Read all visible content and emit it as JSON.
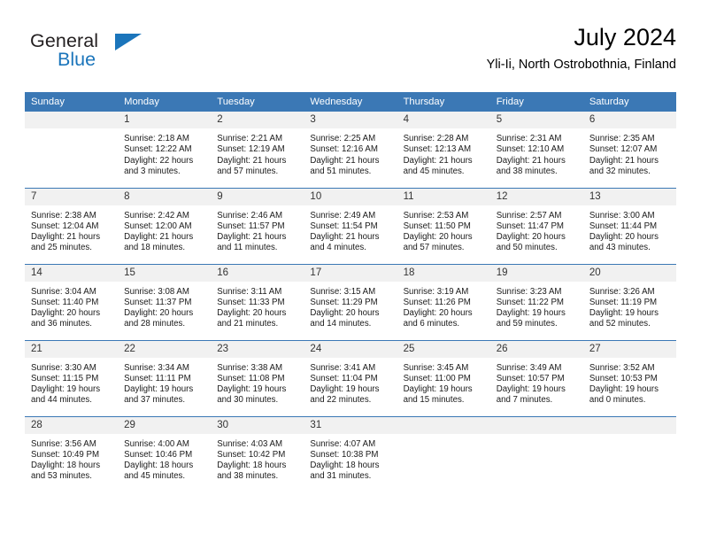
{
  "brand": {
    "word1": "General",
    "word2": "Blue",
    "accent_color": "#1b75bb",
    "triangle_icon": "triangle-icon"
  },
  "header": {
    "title": "July 2024",
    "subtitle": "Yli-Ii, North Ostrobothnia, Finland"
  },
  "calendar": {
    "header_color": "#3b78b5",
    "daynum_bg": "#f1f1f1",
    "weekdays": [
      "Sunday",
      "Monday",
      "Tuesday",
      "Wednesday",
      "Thursday",
      "Friday",
      "Saturday"
    ],
    "weeks": [
      [
        {
          "day": "",
          "empty": true
        },
        {
          "day": "1",
          "sunrise": "Sunrise: 2:18 AM",
          "sunset": "Sunset: 12:22 AM",
          "daylight1": "Daylight: 22 hours",
          "daylight2": "and 3 minutes."
        },
        {
          "day": "2",
          "sunrise": "Sunrise: 2:21 AM",
          "sunset": "Sunset: 12:19 AM",
          "daylight1": "Daylight: 21 hours",
          "daylight2": "and 57 minutes."
        },
        {
          "day": "3",
          "sunrise": "Sunrise: 2:25 AM",
          "sunset": "Sunset: 12:16 AM",
          "daylight1": "Daylight: 21 hours",
          "daylight2": "and 51 minutes."
        },
        {
          "day": "4",
          "sunrise": "Sunrise: 2:28 AM",
          "sunset": "Sunset: 12:13 AM",
          "daylight1": "Daylight: 21 hours",
          "daylight2": "and 45 minutes."
        },
        {
          "day": "5",
          "sunrise": "Sunrise: 2:31 AM",
          "sunset": "Sunset: 12:10 AM",
          "daylight1": "Daylight: 21 hours",
          "daylight2": "and 38 minutes."
        },
        {
          "day": "6",
          "sunrise": "Sunrise: 2:35 AM",
          "sunset": "Sunset: 12:07 AM",
          "daylight1": "Daylight: 21 hours",
          "daylight2": "and 32 minutes."
        }
      ],
      [
        {
          "day": "7",
          "sunrise": "Sunrise: 2:38 AM",
          "sunset": "Sunset: 12:04 AM",
          "daylight1": "Daylight: 21 hours",
          "daylight2": "and 25 minutes."
        },
        {
          "day": "8",
          "sunrise": "Sunrise: 2:42 AM",
          "sunset": "Sunset: 12:00 AM",
          "daylight1": "Daylight: 21 hours",
          "daylight2": "and 18 minutes."
        },
        {
          "day": "9",
          "sunrise": "Sunrise: 2:46 AM",
          "sunset": "Sunset: 11:57 PM",
          "daylight1": "Daylight: 21 hours",
          "daylight2": "and 11 minutes."
        },
        {
          "day": "10",
          "sunrise": "Sunrise: 2:49 AM",
          "sunset": "Sunset: 11:54 PM",
          "daylight1": "Daylight: 21 hours",
          "daylight2": "and 4 minutes."
        },
        {
          "day": "11",
          "sunrise": "Sunrise: 2:53 AM",
          "sunset": "Sunset: 11:50 PM",
          "daylight1": "Daylight: 20 hours",
          "daylight2": "and 57 minutes."
        },
        {
          "day": "12",
          "sunrise": "Sunrise: 2:57 AM",
          "sunset": "Sunset: 11:47 PM",
          "daylight1": "Daylight: 20 hours",
          "daylight2": "and 50 minutes."
        },
        {
          "day": "13",
          "sunrise": "Sunrise: 3:00 AM",
          "sunset": "Sunset: 11:44 PM",
          "daylight1": "Daylight: 20 hours",
          "daylight2": "and 43 minutes."
        }
      ],
      [
        {
          "day": "14",
          "sunrise": "Sunrise: 3:04 AM",
          "sunset": "Sunset: 11:40 PM",
          "daylight1": "Daylight: 20 hours",
          "daylight2": "and 36 minutes."
        },
        {
          "day": "15",
          "sunrise": "Sunrise: 3:08 AM",
          "sunset": "Sunset: 11:37 PM",
          "daylight1": "Daylight: 20 hours",
          "daylight2": "and 28 minutes."
        },
        {
          "day": "16",
          "sunrise": "Sunrise: 3:11 AM",
          "sunset": "Sunset: 11:33 PM",
          "daylight1": "Daylight: 20 hours",
          "daylight2": "and 21 minutes."
        },
        {
          "day": "17",
          "sunrise": "Sunrise: 3:15 AM",
          "sunset": "Sunset: 11:29 PM",
          "daylight1": "Daylight: 20 hours",
          "daylight2": "and 14 minutes."
        },
        {
          "day": "18",
          "sunrise": "Sunrise: 3:19 AM",
          "sunset": "Sunset: 11:26 PM",
          "daylight1": "Daylight: 20 hours",
          "daylight2": "and 6 minutes."
        },
        {
          "day": "19",
          "sunrise": "Sunrise: 3:23 AM",
          "sunset": "Sunset: 11:22 PM",
          "daylight1": "Daylight: 19 hours",
          "daylight2": "and 59 minutes."
        },
        {
          "day": "20",
          "sunrise": "Sunrise: 3:26 AM",
          "sunset": "Sunset: 11:19 PM",
          "daylight1": "Daylight: 19 hours",
          "daylight2": "and 52 minutes."
        }
      ],
      [
        {
          "day": "21",
          "sunrise": "Sunrise: 3:30 AM",
          "sunset": "Sunset: 11:15 PM",
          "daylight1": "Daylight: 19 hours",
          "daylight2": "and 44 minutes."
        },
        {
          "day": "22",
          "sunrise": "Sunrise: 3:34 AM",
          "sunset": "Sunset: 11:11 PM",
          "daylight1": "Daylight: 19 hours",
          "daylight2": "and 37 minutes."
        },
        {
          "day": "23",
          "sunrise": "Sunrise: 3:38 AM",
          "sunset": "Sunset: 11:08 PM",
          "daylight1": "Daylight: 19 hours",
          "daylight2": "and 30 minutes."
        },
        {
          "day": "24",
          "sunrise": "Sunrise: 3:41 AM",
          "sunset": "Sunset: 11:04 PM",
          "daylight1": "Daylight: 19 hours",
          "daylight2": "and 22 minutes."
        },
        {
          "day": "25",
          "sunrise": "Sunrise: 3:45 AM",
          "sunset": "Sunset: 11:00 PM",
          "daylight1": "Daylight: 19 hours",
          "daylight2": "and 15 minutes."
        },
        {
          "day": "26",
          "sunrise": "Sunrise: 3:49 AM",
          "sunset": "Sunset: 10:57 PM",
          "daylight1": "Daylight: 19 hours",
          "daylight2": "and 7 minutes."
        },
        {
          "day": "27",
          "sunrise": "Sunrise: 3:52 AM",
          "sunset": "Sunset: 10:53 PM",
          "daylight1": "Daylight: 19 hours",
          "daylight2": "and 0 minutes."
        }
      ],
      [
        {
          "day": "28",
          "sunrise": "Sunrise: 3:56 AM",
          "sunset": "Sunset: 10:49 PM",
          "daylight1": "Daylight: 18 hours",
          "daylight2": "and 53 minutes."
        },
        {
          "day": "29",
          "sunrise": "Sunrise: 4:00 AM",
          "sunset": "Sunset: 10:46 PM",
          "daylight1": "Daylight: 18 hours",
          "daylight2": "and 45 minutes."
        },
        {
          "day": "30",
          "sunrise": "Sunrise: 4:03 AM",
          "sunset": "Sunset: 10:42 PM",
          "daylight1": "Daylight: 18 hours",
          "daylight2": "and 38 minutes."
        },
        {
          "day": "31",
          "sunrise": "Sunrise: 4:07 AM",
          "sunset": "Sunset: 10:38 PM",
          "daylight1": "Daylight: 18 hours",
          "daylight2": "and 31 minutes."
        },
        {
          "day": "",
          "empty": true
        },
        {
          "day": "",
          "empty": true
        },
        {
          "day": "",
          "empty": true
        }
      ]
    ]
  }
}
